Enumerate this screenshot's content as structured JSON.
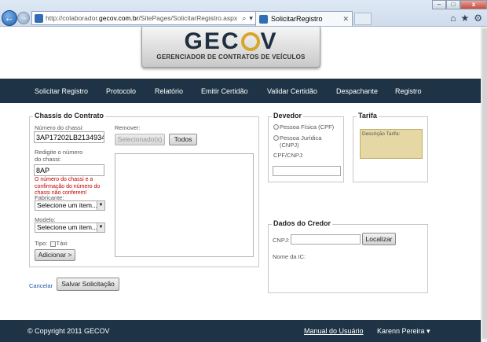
{
  "browser": {
    "address_prefix": "http://colaborador.",
    "address_domain": "gecov.com.br",
    "address_suffix": "/SitePages/SolicitarRegistro.aspx",
    "tab_title": "SolicitarRegistro",
    "back_icon": "arrow-left-icon",
    "home_icon": "home-icon",
    "favorites_icon": "star-icon",
    "tools_icon": "gear-icon"
  },
  "logo": {
    "title_left": "GEC",
    "title_right": "V",
    "subtitle": "GERENCIADOR DE CONTRATOS DE VEÍCULOS"
  },
  "nav": {
    "items": [
      "Solicitar Registro",
      "Protocolo",
      "Relatório",
      "Emitir Certidão",
      "Validar Certidão",
      "Despachante",
      "Registro"
    ]
  },
  "chassis": {
    "legend": "Chassis do Contrato",
    "numero_label": "Número do chassi:",
    "numero_value": "3AP17202LB2134934",
    "redigite_label": "Redigite o número do chassi:",
    "redigite_value": "8AP",
    "error": "O número do chassi e a confirmação do número do chassi não conferem!",
    "fabricante_label": "Fabricante:",
    "fabricante_value": "Selecione um item...",
    "modelo_label": "Modelo:",
    "modelo_value": "Selecione um item...",
    "tipo_label": "Tipo:",
    "taxi_label": "Táxi",
    "adicionar_button": "Adicionar >",
    "remover_label": "Remover:",
    "selecionados_button": "Selecionado(s)",
    "todos_button": "Todos"
  },
  "devedor": {
    "legend": "Devedor",
    "pf_label": "Pessoa Física (CPF)",
    "pj_label": "Pessoa Jurídica (CNPJ)",
    "cpf_cnpj_label": "CPF/CNPJ:"
  },
  "tarifa": {
    "legend": "Tarifa",
    "descricao": "Descrição Tarifa:"
  },
  "credor": {
    "legend": "Dados do Credor",
    "cnpj_label": "CNPJ:",
    "localizar_button": "Localizar",
    "nome_label": "Nome da IC:"
  },
  "actions": {
    "cancelar": "Cancelar",
    "salvar": "Salvar Solicitação"
  },
  "footer": {
    "copyright": "© Copyright 2011 GECOV",
    "manual": "Manual do Usuário",
    "user": "Karenn Pereira ▾"
  }
}
